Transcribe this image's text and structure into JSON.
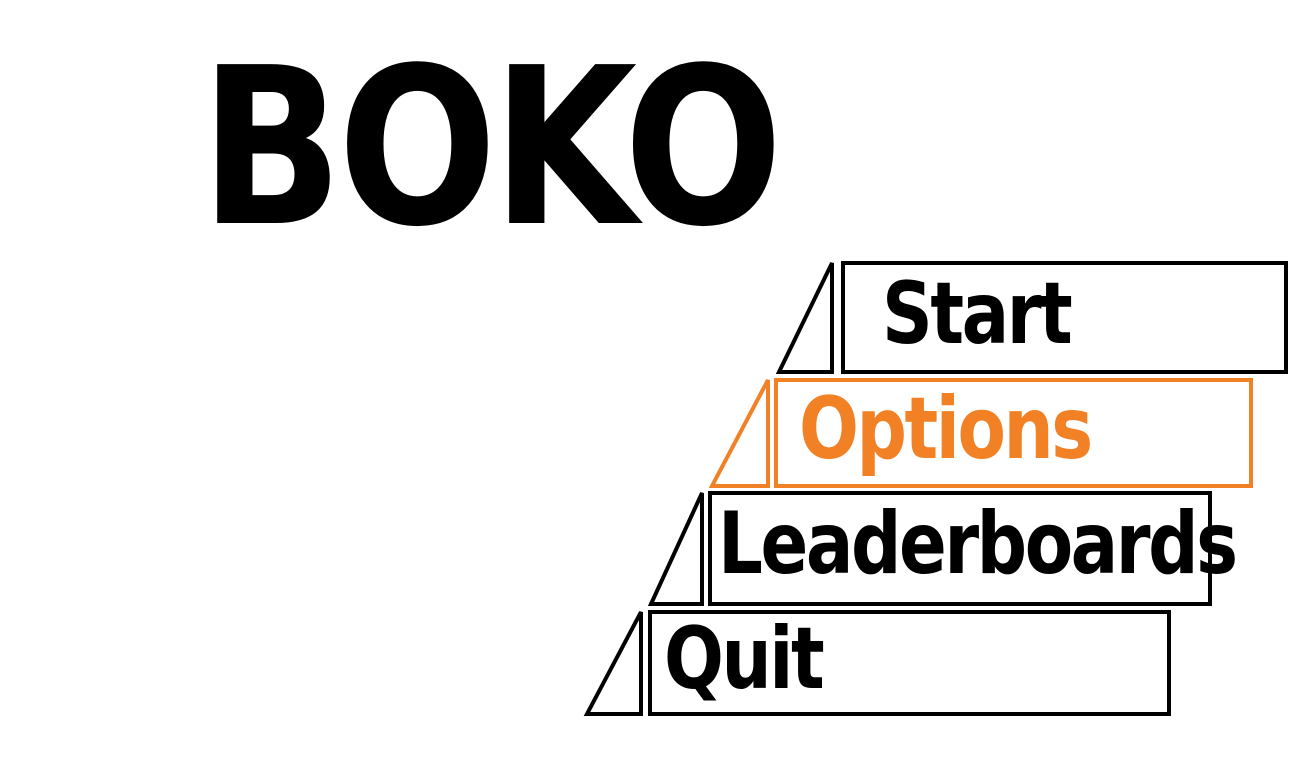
{
  "game": {
    "title": "BOKO"
  },
  "menu": {
    "selected_color": "#f28125",
    "default_color": "#000000",
    "items": [
      {
        "id": "start",
        "label": "Start",
        "selected": false
      },
      {
        "id": "options",
        "label": "Options",
        "selected": true
      },
      {
        "id": "leaderboards",
        "label": "Leaderboards",
        "selected": false
      },
      {
        "id": "quit",
        "label": "Quit",
        "selected": false
      }
    ]
  }
}
